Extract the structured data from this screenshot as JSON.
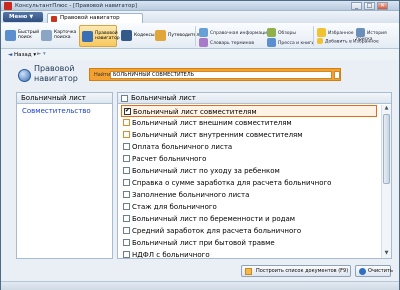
{
  "window": {
    "title": "КонсультантПлюс - [Правовой навигатор]",
    "controls": [
      "_",
      "□",
      "✕"
    ]
  },
  "tabbar": {
    "menu_label": "Меню",
    "active_tab": "Правовой навигатор"
  },
  "toolbar": {
    "buttons": [
      {
        "label": "Быстрый поиск",
        "icon": "quick-search-icon"
      },
      {
        "label": "Карточка поиска",
        "icon": "search-card-icon"
      },
      {
        "label": "Правовой навигатор",
        "icon": "legal-navigator-icon",
        "active": true
      },
      {
        "label": "Кодексы",
        "icon": "codes-icon"
      },
      {
        "label": "Путеводители",
        "icon": "guides-icon"
      }
    ],
    "links": [
      {
        "label": "Справочная информация"
      },
      {
        "label": "Обзоры"
      },
      {
        "label": "Словарь терминов"
      },
      {
        "label": "Пресса и книги"
      },
      {
        "label": "Избранное"
      },
      {
        "label": "История поиска"
      },
      {
        "label": "Добавить в Избранное"
      }
    ]
  },
  "nav": {
    "back_label": "Назад"
  },
  "header": {
    "title_line1": "Правовой",
    "title_line2": "навигатор",
    "search_label": "Найти:",
    "search_value": "БОЛЬНИЧНЫЙ СОВМЕСТИТЕЛЬ"
  },
  "left_pane": {
    "header": "Больничный лист",
    "items": [
      "Совместительство"
    ]
  },
  "right_pane": {
    "header": "Больничный лист",
    "rows": [
      {
        "label": "Больничный лист совместителям",
        "checked": true,
        "selected": true
      },
      {
        "label": "Больничный лист внешним совместителям",
        "related": true
      },
      {
        "label": "Больничный лист внутренним совместителям",
        "related": true
      },
      {
        "label": "Оплата больничного листа"
      },
      {
        "label": "Расчет больничного"
      },
      {
        "label": "Больничный лист по уходу за ребенком"
      },
      {
        "label": "Справка о сумме заработка для расчета больничного"
      },
      {
        "label": "Заполнение больничного листа"
      },
      {
        "label": "Стаж для больничного"
      },
      {
        "label": "Больничный лист по беременности и родам"
      },
      {
        "label": "Средний заработок для расчета больничного"
      },
      {
        "label": "Больничный лист при бытовой травме"
      },
      {
        "label": "НДФЛ с больничного"
      }
    ]
  },
  "footer": {
    "build_label": "Построить список документов (F9)",
    "clear_label": "Очистить"
  },
  "colors": {
    "accent": "#f4a12f",
    "selection_border": "#e36c1a",
    "link": "#1a3fd6"
  }
}
